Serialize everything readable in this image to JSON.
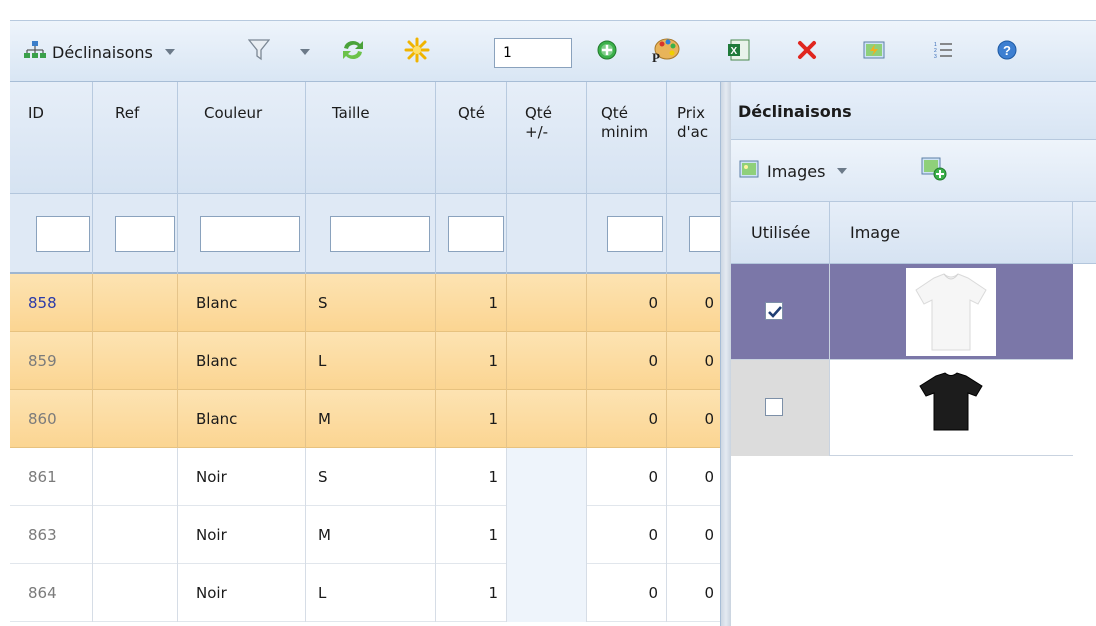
{
  "toolbar": {
    "combinations_label": "Déclinaisons",
    "quantity_value": "1"
  },
  "grid": {
    "columns": [
      {
        "label": "ID"
      },
      {
        "label": "Ref"
      },
      {
        "label": "Couleur"
      },
      {
        "label": "Taille"
      },
      {
        "label": "Qté"
      },
      {
        "label": "Qté\n+/-"
      },
      {
        "label": "Qté\nminim"
      },
      {
        "label": "Prix\nd'ac"
      }
    ],
    "rows": [
      {
        "id": "858",
        "ref": "",
        "couleur": "Blanc",
        "taille": "S",
        "qte": "1",
        "qte_pm": "",
        "qte_min": "0",
        "prix": "0",
        "selected": true
      },
      {
        "id": "859",
        "ref": "",
        "couleur": "Blanc",
        "taille": "L",
        "qte": "1",
        "qte_pm": "",
        "qte_min": "0",
        "prix": "0",
        "selected": true
      },
      {
        "id": "860",
        "ref": "",
        "couleur": "Blanc",
        "taille": "M",
        "qte": "1",
        "qte_pm": "",
        "qte_min": "0",
        "prix": "0",
        "selected": true
      },
      {
        "id": "861",
        "ref": "",
        "couleur": "Noir",
        "taille": "S",
        "qte": "1",
        "qte_pm": "",
        "qte_min": "0",
        "prix": "0",
        "selected": false
      },
      {
        "id": "863",
        "ref": "",
        "couleur": "Noir",
        "taille": "M",
        "qte": "1",
        "qte_pm": "",
        "qte_min": "0",
        "prix": "0",
        "selected": false
      },
      {
        "id": "864",
        "ref": "",
        "couleur": "Noir",
        "taille": "L",
        "qte": "1",
        "qte_pm": "",
        "qte_min": "0",
        "prix": "0",
        "selected": false
      }
    ]
  },
  "panel": {
    "title": "Déclinaisons",
    "images_label": "Images",
    "columns": {
      "used": "Utilisée",
      "image": "Image"
    },
    "images": [
      {
        "used": true,
        "image": "white-tshirt"
      },
      {
        "used": false,
        "image": "black-tshirt"
      }
    ]
  },
  "colors": {
    "selected_row": "#fbd592",
    "selected_image_row": "#7b77a8",
    "header": "#d6e3f2",
    "link": "#2b3aa8"
  }
}
